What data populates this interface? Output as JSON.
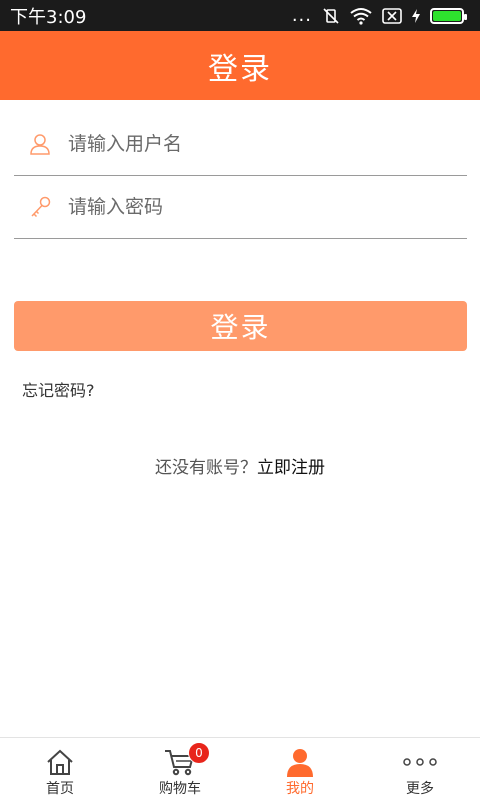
{
  "status_bar": {
    "time": "下午3:09",
    "dots": "..."
  },
  "header": {
    "title": "登录"
  },
  "form": {
    "username_placeholder": "请输入用户名",
    "password_placeholder": "请输入密码",
    "login_button": "登录",
    "forgot_password": "忘记密码?",
    "register_prompt": "还没有账号？",
    "register_link": "立即注册"
  },
  "tabbar": {
    "items": [
      {
        "label": "首页",
        "icon": "home-icon"
      },
      {
        "label": "购物车",
        "icon": "cart-icon",
        "badge": "0"
      },
      {
        "label": "我的",
        "icon": "user-icon",
        "active": true
      },
      {
        "label": "更多",
        "icon": "more-icon"
      }
    ]
  },
  "colors": {
    "accent": "#ff6a2e",
    "button": "#ff9a6b",
    "badge": "#e8251b",
    "status_bar": "#1b1b1b"
  }
}
